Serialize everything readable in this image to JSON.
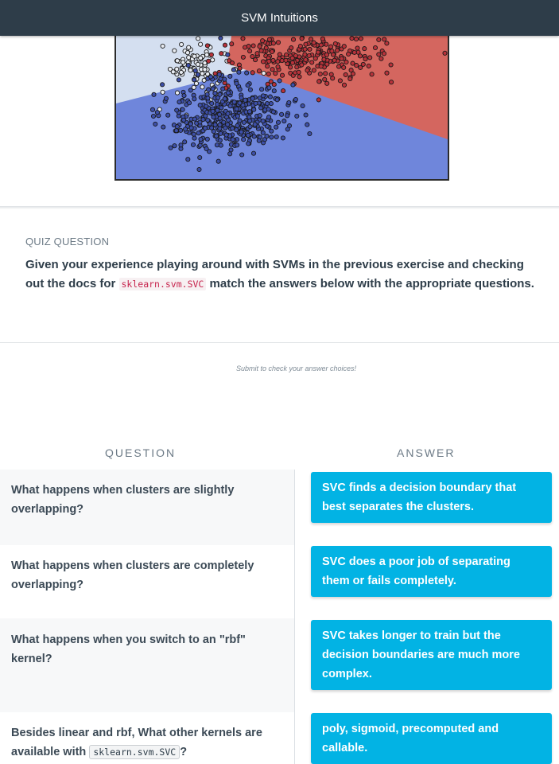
{
  "header": {
    "title": "SVM Intuitions"
  },
  "quiz": {
    "label": "QUIZ QUESTION",
    "text_before": "Given your experience playing around with SVMs in the previous exercise and checking out the docs for",
    "code": "sklearn.svm.SVC",
    "text_after": "match the answers below with the appropriate questions."
  },
  "submit_hint": "Submit to check your answer choices!",
  "columns": {
    "question": "QUESTION",
    "answer": "ANSWER"
  },
  "questions": [
    {
      "text": "What happens when clusters are slightly overlapping?"
    },
    {
      "text": "What happens when clusters are completely overlapping?"
    },
    {
      "text": "What happens when you switch to an \"rbf\" kernel?"
    },
    {
      "text_before": "Besides linear and rbf, What other kernels are available with",
      "code": "sklearn.svm.SVC",
      "text_after": "?"
    }
  ],
  "answers": [
    "SVC finds a decision boundary that best separates the clusters.",
    "SVC does a poor job of separating them or fails completely.",
    "SVC takes longer to train but the decision boundaries are much more complex.",
    "poly, sigmoid, precomputed and callable."
  ],
  "colors": {
    "header_bg": "#2e3d49",
    "answer_bg": "#02b3e4",
    "region_red": "#d4665f",
    "region_blue": "#6f86db",
    "region_light": "#d4dff0"
  }
}
